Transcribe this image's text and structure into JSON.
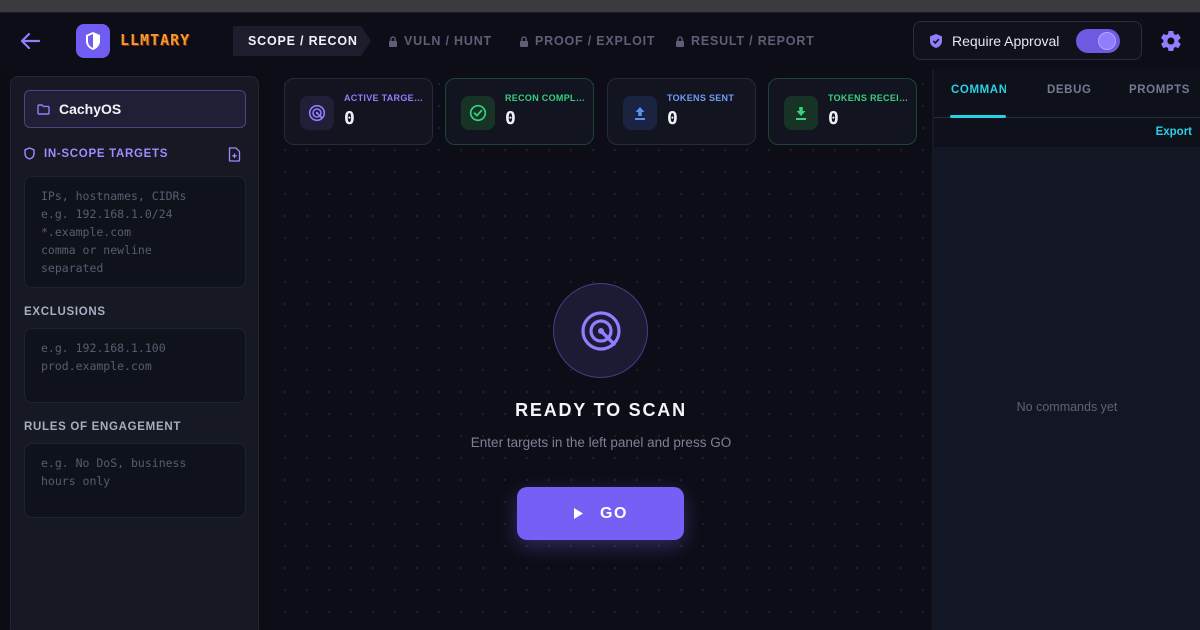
{
  "app": {
    "logo_text": "LLMTARY"
  },
  "header": {
    "steps": [
      {
        "label": "SCOPE / RECON",
        "state": "active"
      },
      {
        "label": "VULN / HUNT",
        "state": "locked"
      },
      {
        "label": "PROOF / EXPLOIT",
        "state": "locked"
      },
      {
        "label": "RESULT / REPORT",
        "state": "locked"
      }
    ],
    "approval_label": "Require Approval",
    "approval_enabled": true
  },
  "sidebar": {
    "project_name": "CachyOS",
    "targets_heading": "IN-SCOPE TARGETS",
    "targets_placeholder": "IPs, hostnames, CIDRs\ne.g. 192.168.1.0/24\n*.example.com\ncomma or newline\nseparated",
    "exclusions_heading": "EXCLUSIONS",
    "exclusions_placeholder": "e.g. 192.168.1.100\nprod.example.com",
    "roe_heading": "RULES OF ENGAGEMENT",
    "roe_placeholder": "e.g. No DoS, business\nhours only"
  },
  "stats": [
    {
      "label": "ACTIVE TARGETS",
      "value": "0",
      "icon": "radar-icon",
      "color": "#8f7fff"
    },
    {
      "label": "RECON COMPLETE",
      "value": "0",
      "icon": "check-circle-icon",
      "color": "#36d07e"
    },
    {
      "label": "TOKENS SENT",
      "value": "0",
      "icon": "upload-icon",
      "color": "#5a8ef5"
    },
    {
      "label": "TOKENS RECEIVED",
      "value": "0",
      "icon": "download-icon",
      "color": "#36d07e"
    }
  ],
  "main": {
    "ready_title": "READY TO SCAN",
    "ready_subtitle": "Enter targets in the left panel and press GO",
    "go_label": "GO"
  },
  "right_panel": {
    "tabs": [
      {
        "label": "COMMANDS",
        "active": true
      },
      {
        "label": "DEBUG",
        "active": false
      },
      {
        "label": "PROMPTS",
        "active": false
      }
    ],
    "export_label": "Export",
    "empty_message": "No commands yet"
  },
  "colors": {
    "accent": "#7560f5",
    "cyan": "#2ad0e6",
    "green": "#36d07e",
    "background": "#0b0c14"
  }
}
